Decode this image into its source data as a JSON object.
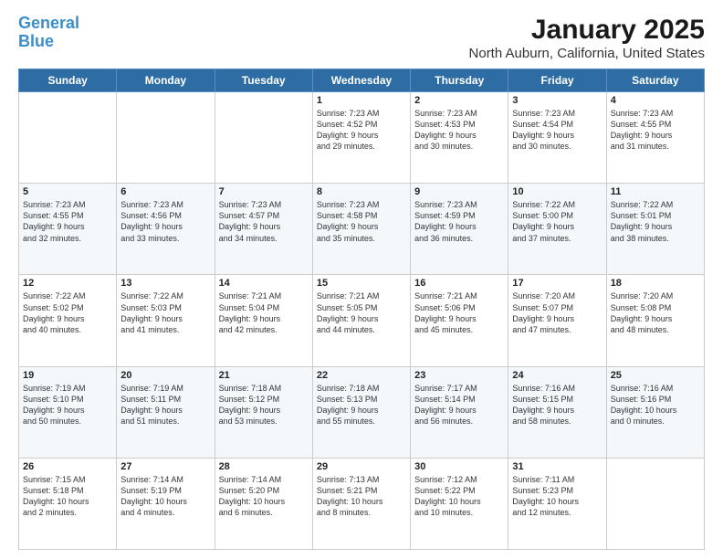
{
  "header": {
    "logo_line1": "General",
    "logo_line2": "Blue",
    "title": "January 2025",
    "subtitle": "North Auburn, California, United States"
  },
  "days_of_week": [
    "Sunday",
    "Monday",
    "Tuesday",
    "Wednesday",
    "Thursday",
    "Friday",
    "Saturday"
  ],
  "weeks": [
    [
      {
        "date": "",
        "info": ""
      },
      {
        "date": "",
        "info": ""
      },
      {
        "date": "",
        "info": ""
      },
      {
        "date": "1",
        "info": "Sunrise: 7:23 AM\nSunset: 4:52 PM\nDaylight: 9 hours\nand 29 minutes."
      },
      {
        "date": "2",
        "info": "Sunrise: 7:23 AM\nSunset: 4:53 PM\nDaylight: 9 hours\nand 30 minutes."
      },
      {
        "date": "3",
        "info": "Sunrise: 7:23 AM\nSunset: 4:54 PM\nDaylight: 9 hours\nand 30 minutes."
      },
      {
        "date": "4",
        "info": "Sunrise: 7:23 AM\nSunset: 4:55 PM\nDaylight: 9 hours\nand 31 minutes."
      }
    ],
    [
      {
        "date": "5",
        "info": "Sunrise: 7:23 AM\nSunset: 4:55 PM\nDaylight: 9 hours\nand 32 minutes."
      },
      {
        "date": "6",
        "info": "Sunrise: 7:23 AM\nSunset: 4:56 PM\nDaylight: 9 hours\nand 33 minutes."
      },
      {
        "date": "7",
        "info": "Sunrise: 7:23 AM\nSunset: 4:57 PM\nDaylight: 9 hours\nand 34 minutes."
      },
      {
        "date": "8",
        "info": "Sunrise: 7:23 AM\nSunset: 4:58 PM\nDaylight: 9 hours\nand 35 minutes."
      },
      {
        "date": "9",
        "info": "Sunrise: 7:23 AM\nSunset: 4:59 PM\nDaylight: 9 hours\nand 36 minutes."
      },
      {
        "date": "10",
        "info": "Sunrise: 7:22 AM\nSunset: 5:00 PM\nDaylight: 9 hours\nand 37 minutes."
      },
      {
        "date": "11",
        "info": "Sunrise: 7:22 AM\nSunset: 5:01 PM\nDaylight: 9 hours\nand 38 minutes."
      }
    ],
    [
      {
        "date": "12",
        "info": "Sunrise: 7:22 AM\nSunset: 5:02 PM\nDaylight: 9 hours\nand 40 minutes."
      },
      {
        "date": "13",
        "info": "Sunrise: 7:22 AM\nSunset: 5:03 PM\nDaylight: 9 hours\nand 41 minutes."
      },
      {
        "date": "14",
        "info": "Sunrise: 7:21 AM\nSunset: 5:04 PM\nDaylight: 9 hours\nand 42 minutes."
      },
      {
        "date": "15",
        "info": "Sunrise: 7:21 AM\nSunset: 5:05 PM\nDaylight: 9 hours\nand 44 minutes."
      },
      {
        "date": "16",
        "info": "Sunrise: 7:21 AM\nSunset: 5:06 PM\nDaylight: 9 hours\nand 45 minutes."
      },
      {
        "date": "17",
        "info": "Sunrise: 7:20 AM\nSunset: 5:07 PM\nDaylight: 9 hours\nand 47 minutes."
      },
      {
        "date": "18",
        "info": "Sunrise: 7:20 AM\nSunset: 5:08 PM\nDaylight: 9 hours\nand 48 minutes."
      }
    ],
    [
      {
        "date": "19",
        "info": "Sunrise: 7:19 AM\nSunset: 5:10 PM\nDaylight: 9 hours\nand 50 minutes."
      },
      {
        "date": "20",
        "info": "Sunrise: 7:19 AM\nSunset: 5:11 PM\nDaylight: 9 hours\nand 51 minutes."
      },
      {
        "date": "21",
        "info": "Sunrise: 7:18 AM\nSunset: 5:12 PM\nDaylight: 9 hours\nand 53 minutes."
      },
      {
        "date": "22",
        "info": "Sunrise: 7:18 AM\nSunset: 5:13 PM\nDaylight: 9 hours\nand 55 minutes."
      },
      {
        "date": "23",
        "info": "Sunrise: 7:17 AM\nSunset: 5:14 PM\nDaylight: 9 hours\nand 56 minutes."
      },
      {
        "date": "24",
        "info": "Sunrise: 7:16 AM\nSunset: 5:15 PM\nDaylight: 9 hours\nand 58 minutes."
      },
      {
        "date": "25",
        "info": "Sunrise: 7:16 AM\nSunset: 5:16 PM\nDaylight: 10 hours\nand 0 minutes."
      }
    ],
    [
      {
        "date": "26",
        "info": "Sunrise: 7:15 AM\nSunset: 5:18 PM\nDaylight: 10 hours\nand 2 minutes."
      },
      {
        "date": "27",
        "info": "Sunrise: 7:14 AM\nSunset: 5:19 PM\nDaylight: 10 hours\nand 4 minutes."
      },
      {
        "date": "28",
        "info": "Sunrise: 7:14 AM\nSunset: 5:20 PM\nDaylight: 10 hours\nand 6 minutes."
      },
      {
        "date": "29",
        "info": "Sunrise: 7:13 AM\nSunset: 5:21 PM\nDaylight: 10 hours\nand 8 minutes."
      },
      {
        "date": "30",
        "info": "Sunrise: 7:12 AM\nSunset: 5:22 PM\nDaylight: 10 hours\nand 10 minutes."
      },
      {
        "date": "31",
        "info": "Sunrise: 7:11 AM\nSunset: 5:23 PM\nDaylight: 10 hours\nand 12 minutes."
      },
      {
        "date": "",
        "info": ""
      }
    ]
  ]
}
